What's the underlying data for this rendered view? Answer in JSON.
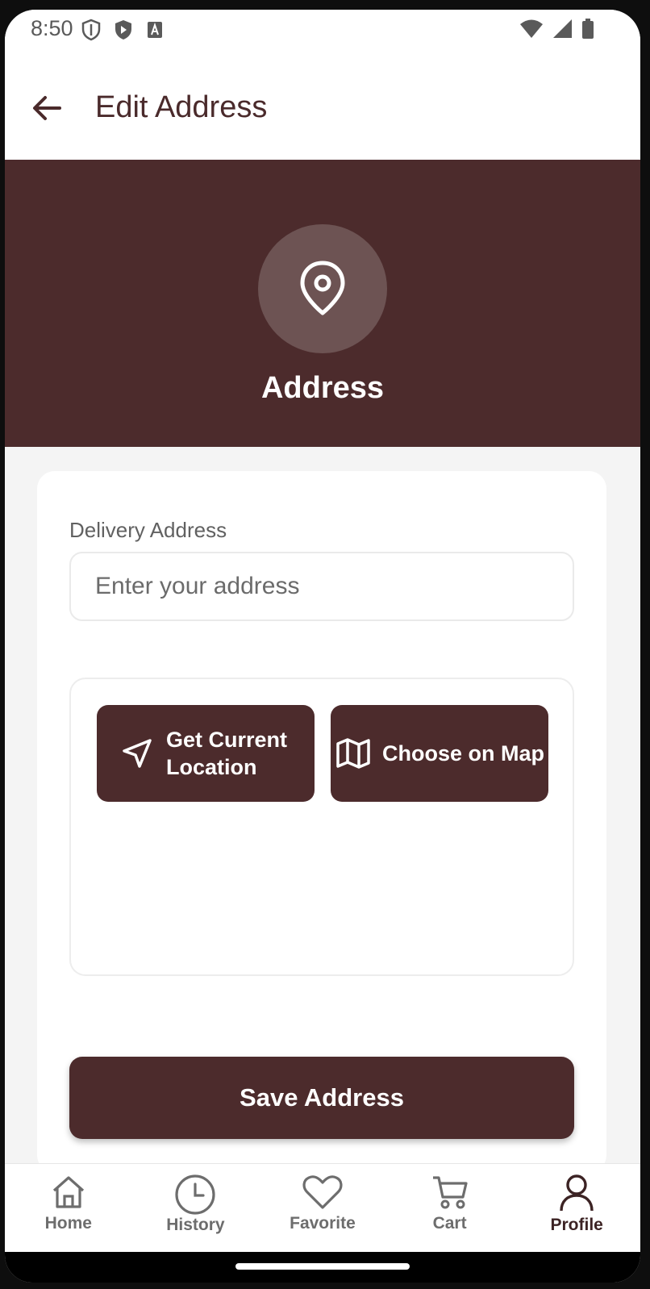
{
  "status_bar": {
    "time": "8:50"
  },
  "app_bar": {
    "title": "Edit Address"
  },
  "header": {
    "label": "Address"
  },
  "form": {
    "field_label": "Delivery Address",
    "address_placeholder": "Enter your address",
    "address_value": "",
    "current_location_label": "Get Current Location",
    "choose_on_map_label": "Choose on Map",
    "save_label": "Save Address"
  },
  "bottom_nav": {
    "items": [
      {
        "label": "Home",
        "icon": "home-icon"
      },
      {
        "label": "History",
        "icon": "clock-icon"
      },
      {
        "label": "Favorite",
        "icon": "heart-icon"
      },
      {
        "label": "Cart",
        "icon": "cart-icon"
      },
      {
        "label": "Profile",
        "icon": "person-icon",
        "active": true
      }
    ]
  },
  "colors": {
    "primary": "#4c2b2c",
    "pin_circle": "#6d5353",
    "background": "#f4f4f4"
  }
}
